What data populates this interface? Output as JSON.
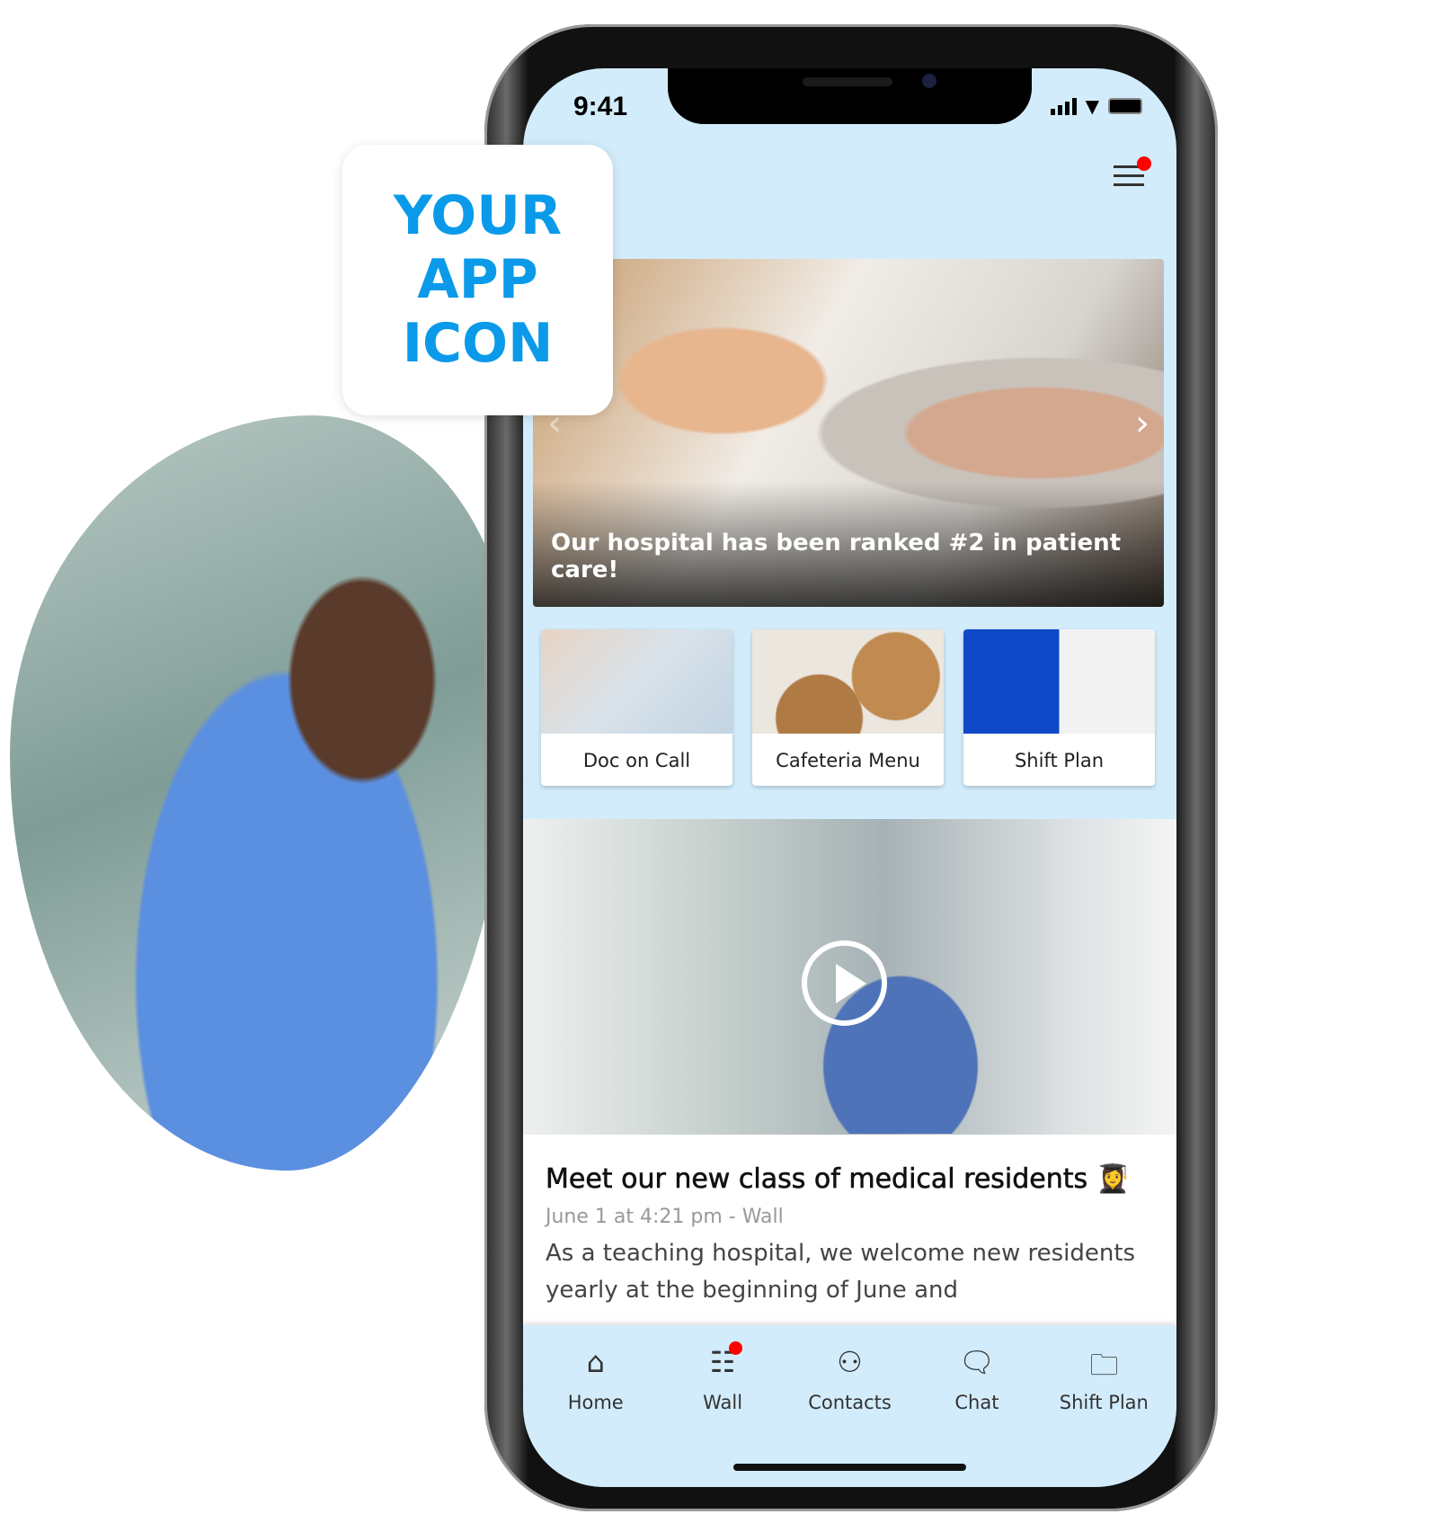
{
  "status": {
    "time": "9:41"
  },
  "promo": {
    "lines": [
      "YOUR",
      "APP",
      "ICON"
    ]
  },
  "hero": {
    "caption": "Our hospital has been ranked #2 in patient care!"
  },
  "tiles": [
    {
      "label": "Doc on Call"
    },
    {
      "label": "Cafeteria Menu"
    },
    {
      "label": "Shift Plan"
    }
  ],
  "post": {
    "title": "Meet our new class of medical residents 👩‍🎓",
    "meta": "June 1 at  4:21 pm - Wall",
    "body": "As a teaching hospital, we welcome new residents yearly at the beginning of June and"
  },
  "tabs": [
    {
      "label": "Home",
      "icon": "home-icon"
    },
    {
      "label": "Wall",
      "icon": "wall-icon"
    },
    {
      "label": "Contacts",
      "icon": "contacts-icon"
    },
    {
      "label": "Chat",
      "icon": "chat-icon"
    },
    {
      "label": "Shift Plan",
      "icon": "folder-icon"
    }
  ],
  "colors": {
    "accent": "#0a9ae9",
    "screen_bg": "#d2ecfb",
    "badge": "#ff0000"
  }
}
